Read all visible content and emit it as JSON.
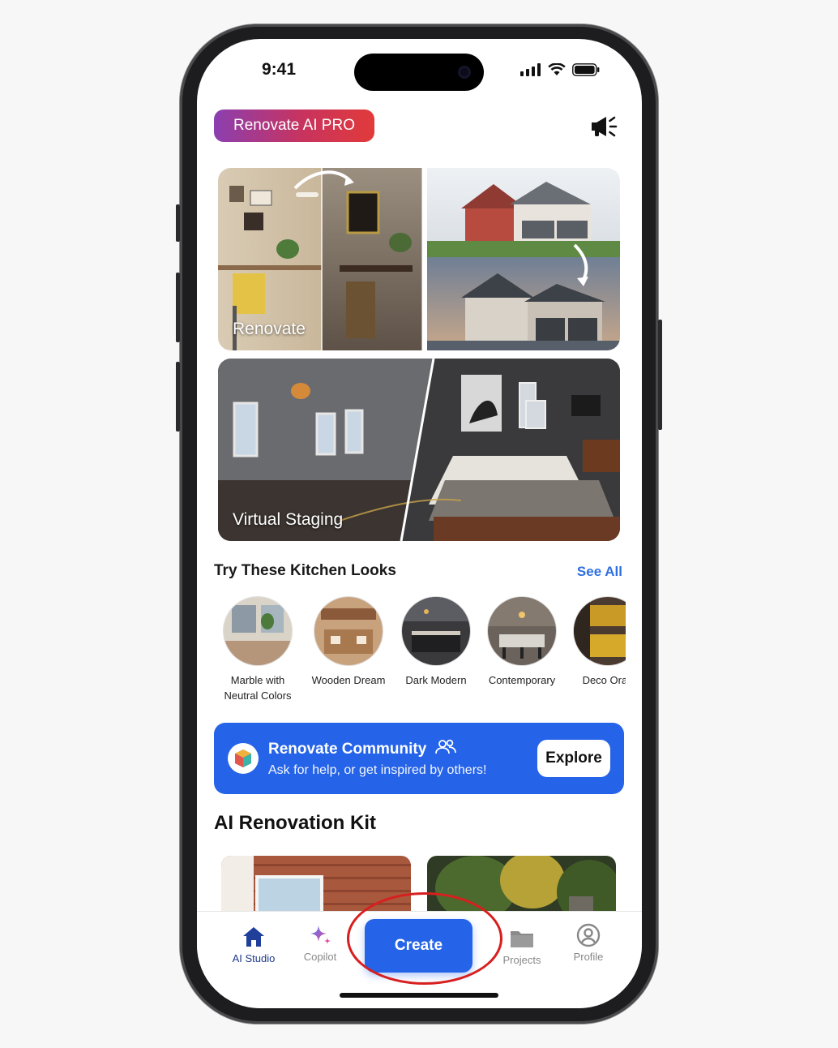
{
  "status_bar": {
    "time": "9:41"
  },
  "header": {
    "pro_label": "Renovate AI PRO",
    "announce_icon": "megaphone-icon"
  },
  "hero_cards": [
    {
      "label": "Renovate"
    },
    {
      "label": "Virtual Staging"
    }
  ],
  "kitchen_looks": {
    "title": "Try These Kitchen Looks",
    "see_all": "See All",
    "items": [
      {
        "line1": "Marble with",
        "line2": "Neutral Colors"
      },
      {
        "line1": "Wooden Dream",
        "line2": ""
      },
      {
        "line1": "Dark Modern",
        "line2": ""
      },
      {
        "line1": "Contemporary",
        "line2": ""
      },
      {
        "line1": "Deco Oran",
        "line2": ""
      }
    ]
  },
  "community": {
    "title": "Renovate Community",
    "subtitle": "Ask for help, or get inspired by others!",
    "button": "Explore"
  },
  "kit": {
    "title": "AI Renovation Kit"
  },
  "tabbar": {
    "items": [
      {
        "label": "AI Studio",
        "icon": "house-icon",
        "active": true
      },
      {
        "label": "Copilot",
        "icon": "sparkle-icon",
        "active": false
      },
      {
        "label": "Projects",
        "icon": "folder-icon",
        "active": false
      },
      {
        "label": "Profile",
        "icon": "person-circle-icon",
        "active": false
      }
    ],
    "create_label": "Create"
  },
  "colors": {
    "accent": "#2563e8",
    "pro_gradient_start": "#8b3fb0",
    "pro_gradient_end": "#e13a3a",
    "highlight_ellipse": "#d71f1f"
  }
}
